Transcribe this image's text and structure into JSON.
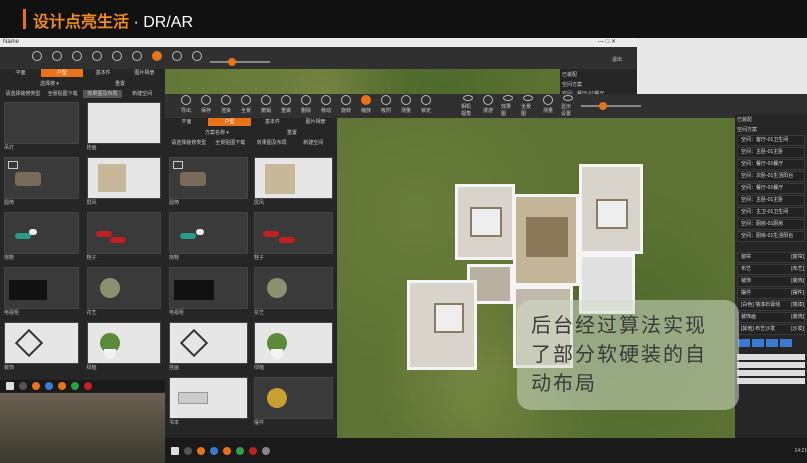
{
  "header": {
    "title_cn": "设计点亮生活",
    "title_sep": " · ",
    "title_en": "DR/AR"
  },
  "back_window": {
    "title": "Name",
    "controls": "—  □  ✕",
    "right_label": "退出",
    "right_panel_title": "已装配",
    "right_panel_items": [
      "空间方案",
      "空间：餐厅-01餐厅"
    ],
    "tabs": [
      "平面",
      "户型",
      "基本件",
      "图片相册"
    ],
    "active_tab": 1,
    "filter_label": "选择按 ▾",
    "filter_right": "重置",
    "sub_tabs": [
      "请选择装修类型",
      "全景贴图下载",
      "效果图及布局",
      "新建空间"
    ],
    "items": [
      {
        "label": "吊灯",
        "thumb": "light"
      },
      {
        "label": "挂画",
        "thumb": "dark"
      },
      {
        "label": "圆椅",
        "thumb": "dark"
      },
      {
        "label": "屏风",
        "thumb": "dark"
      },
      {
        "label": "拖鞋",
        "thumb": "dark"
      },
      {
        "label": "鞋子",
        "thumb": "dark"
      },
      {
        "label": "电视柜",
        "thumb": "dark"
      },
      {
        "label": "花艺",
        "thumb": "dark"
      },
      {
        "label": "装饰",
        "thumb": "dark"
      },
      {
        "label": "绿植",
        "thumb": "dark"
      }
    ]
  },
  "front_window": {
    "toolbar": [
      "导出",
      "保存",
      "渲染",
      "全景",
      "撤销",
      "重做",
      "删除",
      "移动",
      "旋转",
      "缩放",
      "吸附",
      "测量",
      "锁定"
    ],
    "toolbar_right": [
      "相机视角",
      "漫游",
      "效果图",
      "全景图",
      "测量",
      "显示设置"
    ],
    "tabs": [
      "平面",
      "户型",
      "基本件",
      "图片相册"
    ],
    "active_tab": 1,
    "filter_label": "方案名称 ▾",
    "filter_right": "重置",
    "sub_tabs": [
      "请选择装修类型",
      "全景贴图下载",
      "效果图及布局",
      "新建空间"
    ],
    "items": [
      {
        "label": "圆椅"
      },
      {
        "label": "屏风"
      },
      {
        "label": "拖鞋"
      },
      {
        "label": "鞋子"
      },
      {
        "label": "电视柜"
      },
      {
        "label": "花艺"
      },
      {
        "label": "挂画"
      },
      {
        "label": "绿植"
      },
      {
        "label": "书本"
      },
      {
        "label": "摆件"
      }
    ],
    "right_panel_title": "已装配",
    "right_panel_sub": "空间方案",
    "rooms": [
      "空间：客厅-01卫生间",
      "空间：主卧-01主卧",
      "空间：餐厅-01餐厅",
      "空间：次卧-01生活阳台",
      "空间：餐厅-01餐厅",
      "空间：主卧-01主卧",
      "空间：主卫-01卫生间",
      "空间：厨房-01厨房",
      "空间：厨房-01生活阳台"
    ],
    "props": [
      {
        "name": "窗帘",
        "v": "[窗帘]"
      },
      {
        "name": "布艺",
        "v": "[布艺]"
      },
      {
        "name": "装饰",
        "v": "[装饰]"
      },
      {
        "name": "摆件",
        "v": "[摆件]"
      },
      {
        "name": "[白色] 墙漆石膏线",
        "v": "[墙漆]"
      },
      {
        "name": "装饰画",
        "v": "[装饰]"
      },
      {
        "name": "[其他] 布艺沙发",
        "v": "[沙发]"
      }
    ],
    "time": "14:21"
  },
  "caption": {
    "lines": [
      "后台经过算法实现",
      "了部分软硬装的自",
      "动布局"
    ]
  },
  "colors": {
    "accent": "#e8731a",
    "title_orange": "#f08a1c"
  }
}
